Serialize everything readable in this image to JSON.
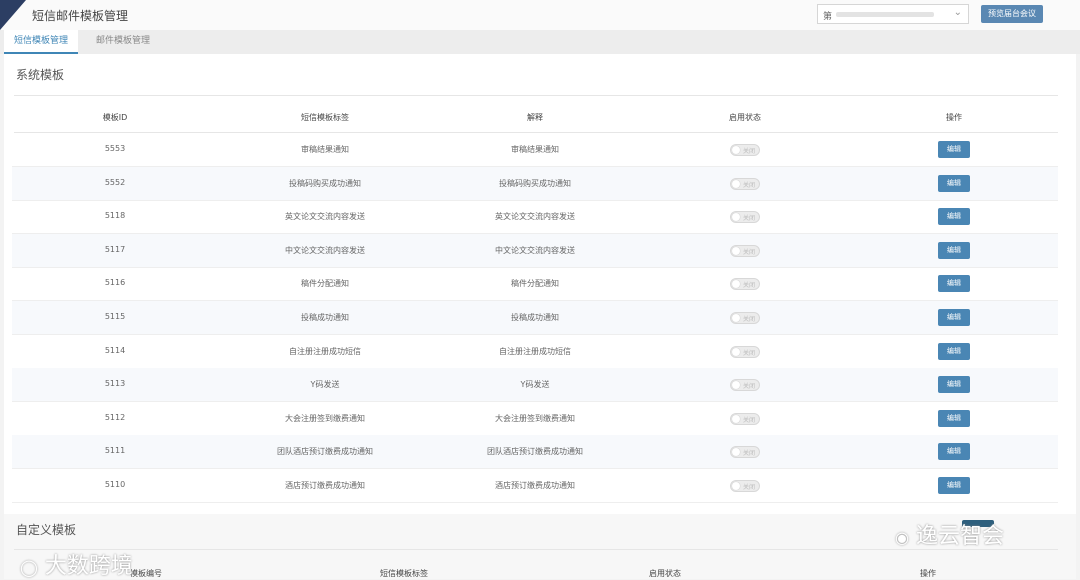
{
  "header": {
    "title": "短信邮件模板管理",
    "conference_select": {
      "value": "第"
    },
    "preview_button": "预览届台会议"
  },
  "tabs": [
    {
      "label": "短信模板管理",
      "active": true
    },
    {
      "label": "邮件模板管理",
      "active": false
    }
  ],
  "system_templates": {
    "title": "系统模板",
    "columns": [
      "模板ID",
      "短信模板标签",
      "解释",
      "启用状态",
      "操作"
    ],
    "rows": [
      {
        "id": "5553",
        "tag": "审稿结果通知",
        "desc": "审稿结果通知",
        "status": "关闭",
        "action": "编辑"
      },
      {
        "id": "5552",
        "tag": "投稿码购买成功通知",
        "desc": "投稿码购买成功通知",
        "status": "关闭",
        "action": "编辑"
      },
      {
        "id": "5118",
        "tag": "英文论文交流内容发送",
        "desc": "英文论文交流内容发送",
        "status": "关闭",
        "action": "编辑"
      },
      {
        "id": "5117",
        "tag": "中文论文交流内容发送",
        "desc": "中文论文交流内容发送",
        "status": "关闭",
        "action": "编辑"
      },
      {
        "id": "5116",
        "tag": "稿件分配通知",
        "desc": "稿件分配通知",
        "status": "关闭",
        "action": "编辑"
      },
      {
        "id": "5115",
        "tag": "投稿成功通知",
        "desc": "投稿成功通知",
        "status": "关闭",
        "action": "编辑"
      },
      {
        "id": "5114",
        "tag": "自注册注册成功短信",
        "desc": "自注册注册成功短信",
        "status": "关闭",
        "action": "编辑"
      },
      {
        "id": "5113",
        "tag": "Y码发送",
        "desc": "Y码发送",
        "status": "关闭",
        "action": "编辑"
      },
      {
        "id": "5112",
        "tag": "大会注册签到缴费通知",
        "desc": "大会注册签到缴费通知",
        "status": "关闭",
        "action": "编辑"
      },
      {
        "id": "5111",
        "tag": "团队酒店预订缴费成功通知",
        "desc": "团队酒店预订缴费成功通知",
        "status": "关闭",
        "action": "编辑"
      },
      {
        "id": "5110",
        "tag": "酒店预订缴费成功通知",
        "desc": "酒店预订缴费成功通知",
        "status": "关闭",
        "action": "编辑"
      }
    ]
  },
  "custom_templates": {
    "title": "自定义模板",
    "columns": [
      "模板编号",
      "短信模板标签",
      "启用状态",
      "操作"
    ]
  },
  "watermarks": {
    "left": "大数跨境",
    "right": "逸云智会"
  }
}
